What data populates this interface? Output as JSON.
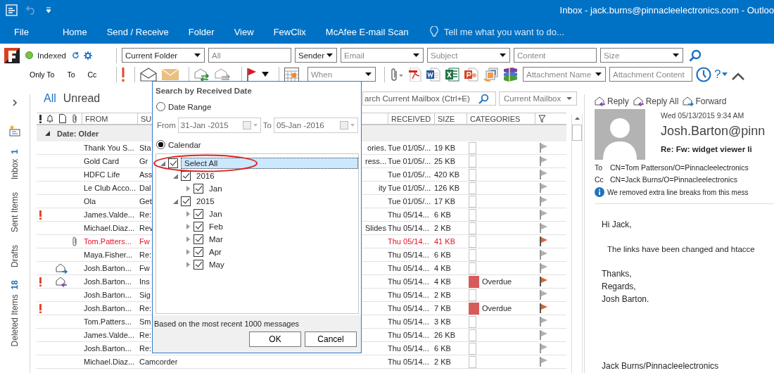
{
  "window": {
    "title": "Inbox - jack.burns@pinnacleelectronics.com - Outloo"
  },
  "ribbon": {
    "tabs": [
      {
        "label": "File",
        "selected": false
      },
      {
        "label": "Home",
        "selected": false
      },
      {
        "label": "Send / Receive",
        "selected": false
      },
      {
        "label": "Folder",
        "selected": false
      },
      {
        "label": "View",
        "selected": false
      },
      {
        "label": "FewClix",
        "selected": false
      },
      {
        "label": "McAfee E-mail Scan",
        "selected": false
      }
    ],
    "tell_me": {
      "placeholder": "Tell me what you want to do..."
    }
  },
  "search_toolbar": {
    "index_status": "Indexed",
    "filters": [
      {
        "kind": "dropdown",
        "value": "Current Folder"
      },
      {
        "kind": "field",
        "placeholder": "All"
      },
      {
        "kind": "dropdown",
        "value": "Sender"
      },
      {
        "kind": "dropdown",
        "placeholder": "Email"
      },
      {
        "kind": "dropdown",
        "placeholder": "Subject"
      },
      {
        "kind": "field",
        "placeholder": "Content"
      },
      {
        "kind": "dropdown",
        "placeholder": "Size"
      }
    ],
    "recipient_buttons": [
      "Only To",
      "To",
      "Cc"
    ],
    "when": {
      "placeholder": "When"
    },
    "attachment_filters": [
      {
        "kind": "dropdown",
        "placeholder": "Attachment Name"
      },
      {
        "kind": "field",
        "placeholder": "Attachment Content"
      }
    ],
    "help": "?"
  },
  "folders": [
    {
      "name": "Inbox",
      "count": "1"
    },
    {
      "name": "Sent Items"
    },
    {
      "name": "Drafts"
    },
    {
      "name": "Deleted Items",
      "count": "18"
    }
  ],
  "mail_list": {
    "filters": [
      {
        "label": "All",
        "selected": true
      },
      {
        "label": "Unread",
        "selected": false
      }
    ],
    "search": {
      "placeholder": "arch Current Mailbox (Ctrl+E)"
    },
    "scope": {
      "value": "Current Mailbox"
    },
    "columns": [
      "FROM",
      "SU",
      "RECEIVED",
      "SIZE",
      "CATEGORIES"
    ],
    "group": {
      "label": "Date: Older",
      "expanded": true
    },
    "rows": [
      {
        "kind": "plain",
        "from": "Thank You S...",
        "subject": "Sta",
        "subject_end": "ories.",
        "received": "Tue 01/05/...",
        "size": "19 KB",
        "important": false,
        "attachment": false,
        "highlighted": false,
        "flagged": false
      },
      {
        "kind": "plain",
        "from": "Gold Card",
        "subject": "Gr",
        "subject_end": "ress...",
        "received": "Tue 01/05/...",
        "size": "25 KB",
        "important": false,
        "attachment": false,
        "highlighted": false,
        "flagged": false
      },
      {
        "kind": "plain",
        "from": "HDFC Life",
        "subject": "Ass",
        "received": "Tue 01/05/...",
        "size": "420 KB",
        "important": false,
        "attachment": false,
        "highlighted": false,
        "flagged": false
      },
      {
        "kind": "plain",
        "from": "Le Club Acco...",
        "subject": "Dal",
        "subject_end": "ity",
        "received": "Tue 01/05/...",
        "size": "126 KB",
        "important": false,
        "attachment": false,
        "highlighted": false,
        "flagged": false
      },
      {
        "kind": "plain",
        "from": "Ola",
        "subject": "Get",
        "received": "Tue 01/05/...",
        "size": "17 KB",
        "important": false,
        "attachment": false,
        "highlighted": false,
        "flagged": false
      },
      {
        "kind": "plain",
        "from": "James.Valde...",
        "subject": "Re:",
        "received": "Thu 05/14...",
        "size": "6 KB",
        "important": true,
        "attachment": false,
        "highlighted": false,
        "flagged": false
      },
      {
        "kind": "plain",
        "from": "Michael.Diaz...",
        "subject": "Rev",
        "subject_end": "Slides",
        "received": "Thu 05/14...",
        "size": "2 KB",
        "important": false,
        "attachment": false,
        "highlighted": false,
        "flagged": false
      },
      {
        "kind": "plain",
        "from": "Tom.Patters...",
        "subject": "Fw",
        "received": "Thu 05/14...",
        "size": "41 KB",
        "important": false,
        "attachment": true,
        "highlighted": true,
        "flagged": true
      },
      {
        "kind": "plain",
        "from": "Maya.Fisher...",
        "subject": "Re:",
        "received": "Thu 05/14...",
        "size": "6 KB",
        "important": false,
        "attachment": false,
        "highlighted": false,
        "flagged": false
      },
      {
        "kind": "forwarded",
        "from": "Josh.Barton...",
        "subject": "Fw",
        "received": "Thu 05/14...",
        "size": "4 KB",
        "important": false,
        "attachment": false,
        "highlighted": false,
        "flagged": false
      },
      {
        "kind": "replied",
        "from": "Josh.Barton...",
        "subject": "Ins",
        "received": "Thu 05/14...",
        "size": "4 KB",
        "important": true,
        "attachment": false,
        "highlighted": false,
        "flagged": true,
        "category": {
          "label": "Overdue",
          "color": "#d65c5c"
        }
      },
      {
        "kind": "plain",
        "from": "Josh.Barton...",
        "subject": "Sig",
        "received": "Thu 05/14...",
        "size": "2 KB",
        "important": false,
        "attachment": false,
        "highlighted": false,
        "flagged": false
      },
      {
        "kind": "plain",
        "from": "Josh.Barton...",
        "subject": "Re:",
        "received": "Thu 05/14...",
        "size": "7 KB",
        "important": true,
        "attachment": false,
        "highlighted": false,
        "flagged": true,
        "category": {
          "label": "Overdue",
          "color": "#d65c5c"
        }
      },
      {
        "kind": "plain",
        "from": "Tom.Patters...",
        "subject": "Sm",
        "received": "Thu 05/14...",
        "size": "3 KB",
        "important": false,
        "attachment": false,
        "highlighted": false,
        "flagged": false
      },
      {
        "kind": "plain",
        "from": "James.Valde...",
        "subject": "Re:",
        "received": "Thu 05/14...",
        "size": "26 KB",
        "important": false,
        "attachment": false,
        "highlighted": false,
        "flagged": false
      },
      {
        "kind": "plain",
        "from": "Josh.Barton...",
        "subject": "Re:",
        "received": "Thu 05/14...",
        "size": "6 KB",
        "important": false,
        "attachment": false,
        "highlighted": false,
        "flagged": false
      },
      {
        "kind": "plain",
        "from": "Michael.Diaz...",
        "subject": "Camcorder",
        "received": "Thu 05/14...",
        "size": "2 KB",
        "important": false,
        "attachment": false,
        "highlighted": false,
        "flagged": false
      }
    ]
  },
  "date_dialog": {
    "title": "Search by Received Date",
    "modes": [
      {
        "label": "Date Range",
        "selected": false
      },
      {
        "label": "Calendar",
        "selected": true
      }
    ],
    "range": {
      "disabled": true,
      "from_label": "From",
      "from": "31-Jan -2015",
      "to_label": "To",
      "to": "05-Jan -2016"
    },
    "tree": [
      {
        "label": "Select All",
        "checked": true,
        "selected": true,
        "expanded": true,
        "children": [
          {
            "label": "2016",
            "checked": true,
            "selected": false,
            "expanded": true,
            "children": [
              {
                "label": "Jan",
                "checked": true,
                "selected": false,
                "expanded": false
              }
            ]
          },
          {
            "label": "2015",
            "checked": true,
            "selected": false,
            "expanded": true,
            "children": [
              {
                "label": "Jan",
                "checked": true,
                "selected": false,
                "expanded": false
              },
              {
                "label": "Feb",
                "checked": true,
                "selected": false,
                "expanded": false
              },
              {
                "label": "Mar",
                "checked": true,
                "selected": false,
                "expanded": false
              },
              {
                "label": "Apr",
                "checked": true,
                "selected": false,
                "expanded": false
              },
              {
                "label": "May",
                "checked": true,
                "selected": false,
                "expanded": false
              }
            ]
          }
        ]
      }
    ],
    "note": "Based on the most recent 1000 messages",
    "buttons": [
      "OK",
      "Cancel"
    ]
  },
  "reading_pane": {
    "actions": [
      "Reply",
      "Reply All",
      "Forward"
    ],
    "date": "Wed 05/13/2015 9:34 AM",
    "sender": "Josh.Barton@pinn",
    "subject": "Re: Fw: widget viewer li",
    "recipients": [
      {
        "label": "To",
        "value": "CN=Tom Patterson/O=Pinnacleelectronics"
      },
      {
        "label": "Cc",
        "value": "CN=Jack Burns/O=Pinnacleelectronics"
      }
    ],
    "info": "We removed extra line breaks from this mess",
    "body": [
      {
        "lines": [
          "Hi Jack,"
        ],
        "indented": false
      },
      {
        "lines": [
          "The links have been changed and htacce"
        ],
        "indented": true
      },
      {
        "lines": [
          "Thanks,",
          "Regards,",
          "Josh Barton."
        ],
        "indented": false
      }
    ],
    "signature": "Jack Burns/Pinnacleelectronics"
  }
}
